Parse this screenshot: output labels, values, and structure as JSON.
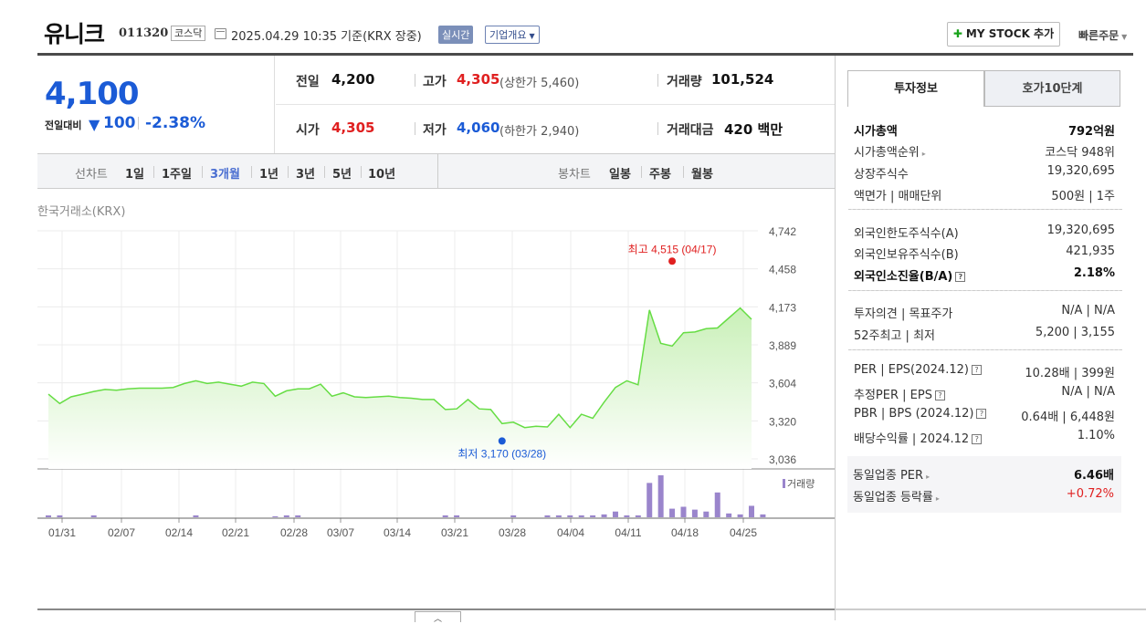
{
  "header": {
    "name": "유니크",
    "code": "011320",
    "market": "코스닥",
    "datetime": "2025.04.29 10:35",
    "basis": "기준(KRX 장중)",
    "realtime": "실시간",
    "overview": "기업개요",
    "mystock": "MY STOCK 추가",
    "quick_order": "빠른주문"
  },
  "price": {
    "current": "4,100",
    "change_label": "전일대비",
    "change": "100",
    "change_pct": "-2.38%"
  },
  "summary": {
    "prev_label": "전일",
    "prev": "4,200",
    "high_label": "고가",
    "high": "4,305",
    "upper": "(상한가 5,460)",
    "volume_label": "거래량",
    "volume": "101,524",
    "open_label": "시가",
    "open": "4,305",
    "low_label": "저가",
    "low": "4,060",
    "lower": "(하한가 2,940)",
    "amount_label": "거래대금",
    "amount": "420 백만"
  },
  "periods": {
    "line_label": "선차트",
    "items": [
      "1일",
      "1주일",
      "3개월",
      "1년",
      "3년",
      "5년",
      "10년"
    ],
    "active": "3개월",
    "candle_label": "봉차트",
    "candles": [
      "일봉",
      "주봉",
      "월봉"
    ]
  },
  "chart_source": "한국거래소(KRX)",
  "chart_data": {
    "type": "area",
    "x": [
      "01/31",
      "02/07",
      "02/14",
      "02/21",
      "02/28",
      "03/07",
      "03/14",
      "03/21",
      "03/28",
      "04/04",
      "04/11",
      "04/18",
      "04/25"
    ],
    "y_ticks": [
      "4,742",
      "4,458",
      "4,173",
      "3,889",
      "3,604",
      "3,320",
      "3,036"
    ],
    "ylim": [
      3036,
      4742
    ],
    "series": [
      {
        "values": [
          3520,
          3450,
          3500,
          3520,
          3540,
          3555,
          3550,
          3560,
          3565,
          3565,
          3565,
          3570,
          3600,
          3620,
          3600,
          3610,
          3595,
          3580,
          3610,
          3600,
          3505,
          3545,
          3560,
          3560,
          3595,
          3505,
          3530,
          3500,
          3495,
          3500,
          3505,
          3495,
          3490,
          3480,
          3480,
          3405,
          3410,
          3480,
          3410,
          3405,
          3300,
          3310,
          3270,
          3280,
          3275,
          3370,
          3270,
          3370,
          3340,
          3460,
          3570,
          3620,
          3590,
          4150,
          3900,
          3880,
          3980,
          3985,
          4010,
          4015,
          4090,
          4165,
          4080
        ]
      }
    ],
    "max_label": "최고 4,515 (04/17)",
    "max_value": 4515,
    "max_index": 55,
    "min_label": "최저 3,170 (03/28)",
    "min_value": 3170,
    "min_index": 40,
    "volume_label": "거래량",
    "volumes": [
      2,
      2,
      0,
      0,
      2,
      0,
      0,
      0,
      0,
      0,
      0,
      0,
      0,
      2,
      0,
      0,
      0,
      0,
      0,
      0,
      1,
      2,
      2,
      0,
      0,
      0,
      0,
      0,
      0,
      0,
      0,
      0,
      0,
      0,
      0,
      2,
      2,
      0,
      0,
      0,
      0,
      2,
      0,
      0,
      2,
      2,
      2,
      2,
      2,
      3,
      6,
      2,
      2,
      36,
      44,
      9,
      11,
      8,
      6,
      26,
      4,
      3,
      12,
      3
    ],
    "colors": {
      "line": "#66dd44",
      "fill_top": "#c9f0b8",
      "max": "#e02020",
      "min": "#1b5bd6",
      "volume": "#9a85cc"
    }
  },
  "right_panel": {
    "tab_invest": "투자정보",
    "tab_hoga": "호가10단계",
    "rows": [
      {
        "l": "시가총액",
        "v": "792억원",
        "bold": true
      },
      {
        "l": "시가총액순위",
        "v": "코스닥 948위",
        "tri": true
      },
      {
        "l": "상장주식수",
        "v": "19,320,695"
      },
      {
        "l": "액면가 | 매매단위",
        "v": "500원 | 1주"
      },
      {
        "l": "외국인한도주식수(A)",
        "v": "19,320,695"
      },
      {
        "l": "외국인보유주식수(B)",
        "v": "421,935"
      },
      {
        "l": "외국인소진율(B/A)",
        "v": "2.18%",
        "bold": true,
        "q": true
      },
      {
        "l": "투자의견 | 목표주가",
        "v": "N/A | N/A"
      },
      {
        "l": "52주최고 | 최저",
        "v": "5,200 | 3,155"
      },
      {
        "l": "PER | EPS(2024.12)",
        "v": "10.28배 | 399원",
        "q": true
      },
      {
        "l": "추정PER | EPS",
        "v": "N/A | N/A",
        "q": true
      },
      {
        "l": "PBR | BPS (2024.12)",
        "v": "0.64배 | 6,448원",
        "q": true
      },
      {
        "l": "배당수익률 | 2024.12",
        "v": "1.10%",
        "q": true
      }
    ],
    "foot": [
      {
        "l": "동일업종 PER",
        "v": "6.46배"
      },
      {
        "l": "동일업종 등락률",
        "v": "+0.72%"
      }
    ]
  }
}
